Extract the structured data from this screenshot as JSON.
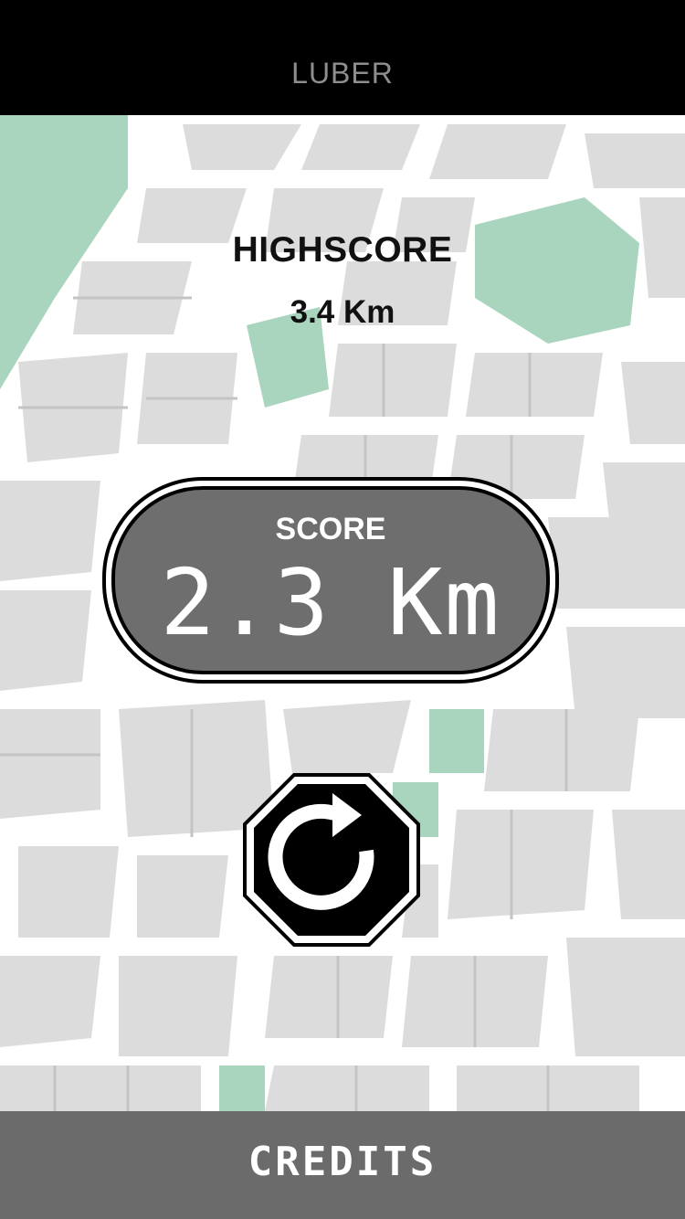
{
  "app": {
    "title": "LUBER"
  },
  "highscore": {
    "label": "HIGHSCORE",
    "value": "3.4 Km"
  },
  "score": {
    "label": "SCORE",
    "value": "2.3 Km"
  },
  "restart": {
    "icon": "restart-arrow-icon"
  },
  "footer": {
    "credits_label": "CREDITS"
  },
  "colors": {
    "top_bar": "#000000",
    "title_text": "#8e8e8e",
    "map_road": "#ffffff",
    "map_block": "#dcdcdc",
    "map_park": "#a9d4bd",
    "score_panel": "#6e6e6e",
    "footer_bar": "#6b6b6b"
  }
}
